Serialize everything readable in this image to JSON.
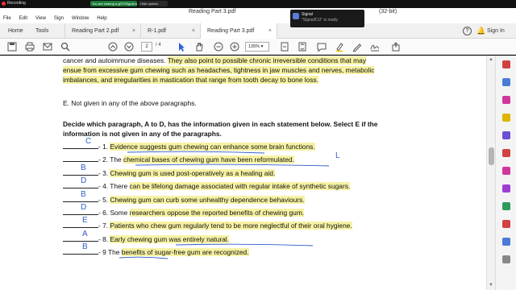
{
  "recorder": {
    "label": "Recording",
    "share_notice": "You are sharing a glTF/Signal screen",
    "hide_label": "Hide options"
  },
  "window": {
    "title": "Reading Part 3.pdf",
    "title_suffix": "(32-bit)"
  },
  "notification": {
    "app": "Signal",
    "message": "\"SignalICU\" is ready"
  },
  "menu": [
    "File",
    "Edit",
    "View",
    "Sign",
    "Window",
    "Help"
  ],
  "tabs": {
    "home": "Home",
    "tools": "Tools",
    "docs": [
      "Reading Part 2.pdf",
      "R-1.pdf",
      "Reading Part 3.pdf"
    ],
    "close_glyph": "×",
    "help": "?",
    "sign_in": "Sign In"
  },
  "toolbar": {
    "page_current": "2",
    "page_total": "/ 4",
    "zoom": "135%"
  },
  "document": {
    "intro_lines": [
      [
        {
          "t": "cancer and autoimmune diseases. ",
          "h": false
        },
        {
          "t": "They also point to possible chronic irreversible conditions that may",
          "h": true
        }
      ],
      [
        {
          "t": "ensue from excessive gum chewing such as headaches, tightness in jaw muscles and nerves, metabolic",
          "h": true
        }
      ],
      [
        {
          "t": "imbalances, and irregularities in mastication that range from tooth decay to bone loss.",
          "h": true
        }
      ]
    ],
    "option_e": "E. Not given in any of the above paragraphs.",
    "instruction_1": "Decide which paragraph, A to D, has the information given in each statement below. Select E if the",
    "instruction_2": "information is not given in any of the paragraphs.",
    "questions": [
      {
        "num": "- 1. ",
        "parts": [
          {
            "t": "Evidence suggests gum chewing can enhance some brain functions.",
            "h": true
          }
        ],
        "answer": "C"
      },
      {
        "num": "- 2. ",
        "parts": [
          {
            "t": "The ",
            "h": false
          },
          {
            "t": "chemical bases of chewing gum have been reformulated.",
            "h": true
          }
        ],
        "answer": "",
        "side_mark": "L"
      },
      {
        "num": "- 3. ",
        "parts": [
          {
            "t": "Chewing gum is used post-operatively as a healing aid.",
            "h": true
          }
        ],
        "answer": "B"
      },
      {
        "num": "- 4. ",
        "parts": [
          {
            "t": "There ",
            "h": false
          },
          {
            "t": "can be lifelong damage associated with regular intake of synthetic sugars.",
            "h": true
          }
        ],
        "answer": "D"
      },
      {
        "num": "- 5. ",
        "parts": [
          {
            "t": "Chewing gum can curb some unhealthy dependence behaviours.",
            "h": true
          }
        ],
        "answer": "B"
      },
      {
        "num": "- 6. ",
        "parts": [
          {
            "t": "Some ",
            "h": false
          },
          {
            "t": "researchers oppose the reported benefits of chewing gum.",
            "h": true
          }
        ],
        "answer": "D"
      },
      {
        "num": "- 7. ",
        "parts": [
          {
            "t": "Patients who chew gum regularly tend to be more neglectful of their oral hygiene.",
            "h": true
          }
        ],
        "answer": "E"
      },
      {
        "num": "- 8. ",
        "parts": [
          {
            "t": "Early chewing gum was entirely natural.",
            "h": true
          }
        ],
        "answer": "A"
      },
      {
        "num": "- 9 The ",
        "parts": [
          {
            "t": "benefits of sugar-free gum are recognized.",
            "h": true
          }
        ],
        "answer": "B"
      }
    ]
  },
  "colors": {
    "highlight": "#f7f2a3",
    "ink": "#2d5ec7",
    "accent": "#e34040"
  },
  "icons": [
    "save-icon",
    "print-icon",
    "mail-icon",
    "search-icon",
    "page-up-icon",
    "page-down-icon",
    "select-cursor-icon",
    "hand-icon",
    "zoom-out-icon",
    "zoom-in-icon",
    "fit-page-icon",
    "scroll-icon",
    "comment-icon",
    "highlight-icon",
    "draw-icon",
    "signature-icon",
    "share-icon"
  ]
}
